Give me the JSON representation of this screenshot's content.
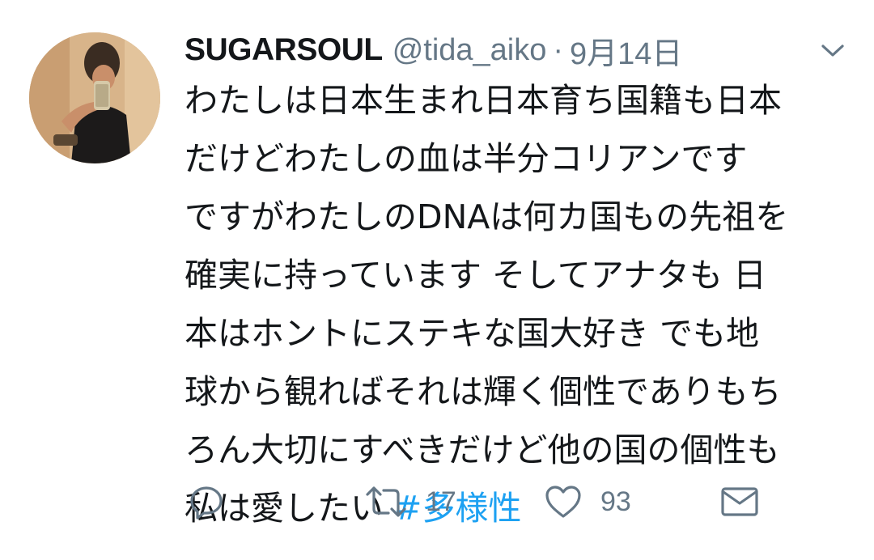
{
  "tweet": {
    "display_name": "SUGARSOUL",
    "handle": "@tida_aiko",
    "separator": "·",
    "date": "9月14日",
    "lines": [
      "わたしは日本生まれ日本育ち国籍も日本",
      "だけどわたしの血は半分コリアンです",
      "ですがわたしのDNAは何カ国もの先祖を",
      "確実に持っています そしてアナタも 日",
      "本はホントにステキな国大好き でも地",
      "球から観ればそれは輝く個性でありもち",
      "ろん大切にすべきだけど他の国の個性も",
      "私は愛したい "
    ],
    "hashtag": "#多様性"
  },
  "actions": {
    "reply_icon": "reply-icon",
    "retweet_icon": "retweet-icon",
    "retweet_count": "17",
    "like_icon": "heart-icon",
    "like_count": "93",
    "dm_icon": "envelope-icon"
  },
  "colors": {
    "text": "#14171a",
    "secondary": "#657786",
    "link": "#1da1f2",
    "icon": "#657786"
  }
}
